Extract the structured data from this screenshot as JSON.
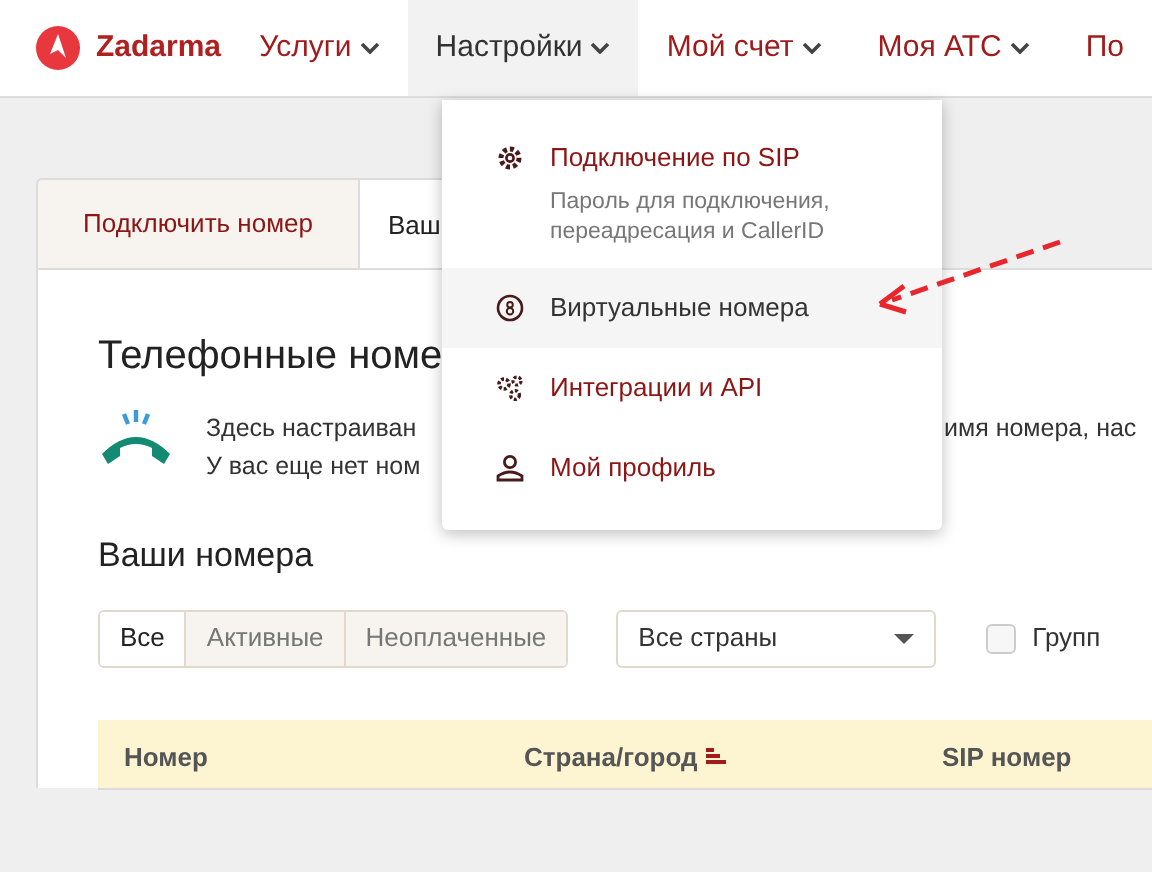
{
  "nav": {
    "logo": "Zadarma",
    "items": [
      {
        "label": "Услуги",
        "selected": false,
        "caret": true
      },
      {
        "label": "Настройки",
        "selected": true,
        "caret": true
      },
      {
        "label": "Мой счет",
        "selected": false,
        "caret": true
      },
      {
        "label": "Моя АТС",
        "selected": false,
        "caret": true
      },
      {
        "label": "По",
        "selected": false,
        "caret": false
      }
    ]
  },
  "tabs": [
    {
      "label": "Подключить номер",
      "selected": false
    },
    {
      "label": "Ваш",
      "selected": true
    }
  ],
  "heading": "Телефонные номе",
  "intro": {
    "line_1_left": "Здесь настраиван",
    "line_1_right": "имя номера, нас",
    "line_2": "У вас еще нет ном"
  },
  "section_title": "Ваши номера",
  "filters": [
    {
      "label": "Все",
      "selected": true
    },
    {
      "label": "Активные",
      "selected": false
    },
    {
      "label": "Неоплаченные",
      "selected": false
    }
  ],
  "country_select": {
    "value": "Все страны"
  },
  "group_checkbox": {
    "label": "Групп",
    "checked": false
  },
  "table": {
    "columns": [
      {
        "label": "Номер",
        "sorted": false
      },
      {
        "label": "Страна/город",
        "sorted": true
      },
      {
        "label": "SIP номер",
        "sorted": false
      }
    ]
  },
  "menu": {
    "items": [
      {
        "label": "Подключение по SIP",
        "description": "Пароль для подключения, переадресация и CallerID",
        "selected": false
      },
      {
        "label": "Виртуальные номера",
        "selected": true
      },
      {
        "label": "Интеграции и API",
        "selected": false
      },
      {
        "label": "Мой профиль",
        "selected": false
      }
    ]
  }
}
